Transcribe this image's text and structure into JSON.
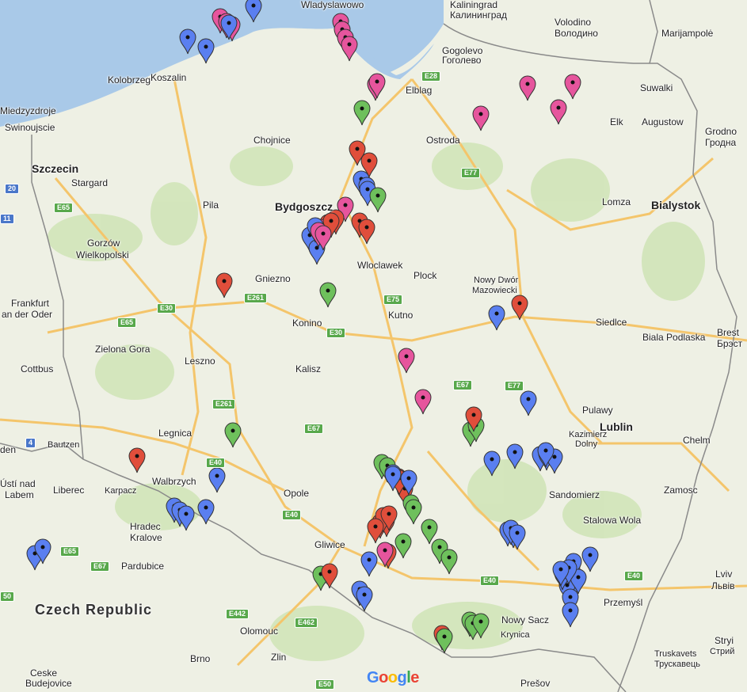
{
  "map": {
    "colors": {
      "land": "#eef0e4",
      "sea": "#a9c9e8",
      "border": "#8a8a8a",
      "road": "#f4c56b",
      "marker_blue": "#5a7ff0",
      "marker_red": "#e04e3b",
      "marker_green": "#6ec05c",
      "marker_pink": "#e6559d"
    },
    "labels": [
      {
        "text": "Wladyslawowo"
      },
      {
        "text": "Kaliningrad"
      },
      {
        "text": "Калининград"
      },
      {
        "text": "Volodino"
      },
      {
        "text": "Володино"
      },
      {
        "text": "Marijampolė"
      },
      {
        "text": "Gogolevo"
      },
      {
        "text": "Гоголево"
      },
      {
        "text": "Kolobrzeg"
      },
      {
        "text": "Koszalin"
      },
      {
        "text": "Elblag"
      },
      {
        "text": "Suwalki"
      },
      {
        "text": "Miedzyzdroje"
      },
      {
        "text": "Swinoujscie"
      },
      {
        "text": "Chojnice"
      },
      {
        "text": "Ostroda"
      },
      {
        "text": "Elk"
      },
      {
        "text": "Augustow"
      },
      {
        "text": "Grodno"
      },
      {
        "text": "Гродна"
      },
      {
        "text": "Szczecin"
      },
      {
        "text": "Stargard"
      },
      {
        "text": "Bydgoszcz"
      },
      {
        "text": "Pila"
      },
      {
        "text": "Lomza"
      },
      {
        "text": "Bialystok"
      },
      {
        "text": "Gorzów"
      },
      {
        "text": "Wielkopolski"
      },
      {
        "text": "Wloclawek"
      },
      {
        "text": "Gniezno"
      },
      {
        "text": "Plock"
      },
      {
        "text": "Nowy Dwór"
      },
      {
        "text": "Mazowiecki"
      },
      {
        "text": "Frankfurt"
      },
      {
        "text": "an der Oder"
      },
      {
        "text": "Konino"
      },
      {
        "text": "Kutno"
      },
      {
        "text": "Siedlce"
      },
      {
        "text": "Brest"
      },
      {
        "text": "Брэст"
      },
      {
        "text": "Biala Podlaska"
      },
      {
        "text": "Zielona Gora"
      },
      {
        "text": "Cottbus"
      },
      {
        "text": "Leszno"
      },
      {
        "text": "Kalisz"
      },
      {
        "text": "Pulawy"
      },
      {
        "text": "Lublin"
      },
      {
        "text": "Kazimierz"
      },
      {
        "text": "Dolny"
      },
      {
        "text": "Chelm"
      },
      {
        "text": "Legnica"
      },
      {
        "text": "Bautzen"
      },
      {
        "text": "den"
      },
      {
        "text": "Walbrzych"
      },
      {
        "text": "Ústí nad"
      },
      {
        "text": "Labem"
      },
      {
        "text": "Liberec"
      },
      {
        "text": "Karpacz"
      },
      {
        "text": "Opole"
      },
      {
        "text": "Sandomierz"
      },
      {
        "text": "Zamosc"
      },
      {
        "text": "Hradec"
      },
      {
        "text": "Kralove"
      },
      {
        "text": "Stalowa Wola"
      },
      {
        "text": "Gliwice"
      },
      {
        "text": "Pardubice"
      },
      {
        "text": "Lviv"
      },
      {
        "text": "Львів"
      },
      {
        "text": "Czech Republic"
      },
      {
        "text": "Przemyśl"
      },
      {
        "text": "Olomouc"
      },
      {
        "text": "Nowy Sacz"
      },
      {
        "text": "Krynica"
      },
      {
        "text": "Stryi"
      },
      {
        "text": "Стрий"
      },
      {
        "text": "Zlin"
      },
      {
        "text": "Truskavets"
      },
      {
        "text": "Трускавець"
      },
      {
        "text": "Brno"
      },
      {
        "text": "Ceske"
      },
      {
        "text": "Budejovice"
      },
      {
        "text": "Prešov"
      }
    ],
    "road_shields": [
      "E28",
      "20",
      "E65",
      "E77",
      "E261",
      "E30",
      "E75",
      "E30",
      "E65",
      "E67",
      "E77",
      "E261",
      "E67",
      "4",
      "E40",
      "E40",
      "E65",
      "E67",
      "E40",
      "E40",
      "E462",
      "E442",
      "50",
      "E50",
      "11"
    ],
    "markers": [
      {
        "color": "blue"
      },
      {
        "color": "pink"
      },
      {
        "color": "pink"
      },
      {
        "color": "pink"
      },
      {
        "color": "blue"
      },
      {
        "color": "blue"
      },
      {
        "color": "blue"
      },
      {
        "color": "pink"
      },
      {
        "color": "pink"
      },
      {
        "color": "pink"
      },
      {
        "color": "pink"
      },
      {
        "color": "pink"
      },
      {
        "color": "pink"
      },
      {
        "color": "pink"
      },
      {
        "color": "pink"
      },
      {
        "color": "pink"
      },
      {
        "color": "pink"
      },
      {
        "color": "green"
      },
      {
        "color": "red"
      },
      {
        "color": "red"
      },
      {
        "color": "blue"
      },
      {
        "color": "blue"
      },
      {
        "color": "blue"
      },
      {
        "color": "green"
      },
      {
        "color": "pink"
      },
      {
        "color": "red"
      },
      {
        "color": "red"
      },
      {
        "color": "pink"
      },
      {
        "color": "red"
      },
      {
        "color": "red"
      },
      {
        "color": "red"
      },
      {
        "color": "blue"
      },
      {
        "color": "blue"
      },
      {
        "color": "blue"
      },
      {
        "color": "pink"
      },
      {
        "color": "pink"
      },
      {
        "color": "red"
      },
      {
        "color": "green"
      },
      {
        "color": "red"
      },
      {
        "color": "blue"
      },
      {
        "color": "pink"
      },
      {
        "color": "pink"
      },
      {
        "color": "blue"
      },
      {
        "color": "green"
      },
      {
        "color": "green"
      },
      {
        "color": "red"
      },
      {
        "color": "blue"
      },
      {
        "color": "blue"
      },
      {
        "color": "blue"
      },
      {
        "color": "blue"
      },
      {
        "color": "blue"
      },
      {
        "color": "blue"
      },
      {
        "color": "green"
      },
      {
        "color": "red"
      },
      {
        "color": "blue"
      },
      {
        "color": "blue"
      },
      {
        "color": "blue"
      },
      {
        "color": "blue"
      },
      {
        "color": "blue"
      },
      {
        "color": "green"
      },
      {
        "color": "green"
      },
      {
        "color": "red"
      },
      {
        "color": "blue"
      },
      {
        "color": "red"
      },
      {
        "color": "green"
      },
      {
        "color": "red"
      },
      {
        "color": "red"
      },
      {
        "color": "red"
      },
      {
        "color": "red"
      },
      {
        "color": "red"
      },
      {
        "color": "green"
      },
      {
        "color": "green"
      },
      {
        "color": "green"
      },
      {
        "color": "green"
      },
      {
        "color": "green"
      },
      {
        "color": "blue"
      },
      {
        "color": "blue"
      },
      {
        "color": "blue"
      },
      {
        "color": "blue"
      },
      {
        "color": "red"
      },
      {
        "color": "pink"
      },
      {
        "color": "red"
      },
      {
        "color": "green"
      },
      {
        "color": "red"
      },
      {
        "color": "blue"
      },
      {
        "color": "blue"
      },
      {
        "color": "blue"
      },
      {
        "color": "blue"
      },
      {
        "color": "blue"
      },
      {
        "color": "blue"
      },
      {
        "color": "blue"
      },
      {
        "color": "blue"
      },
      {
        "color": "blue"
      },
      {
        "color": "blue"
      },
      {
        "color": "blue"
      },
      {
        "color": "blue"
      },
      {
        "color": "blue"
      },
      {
        "color": "blue"
      },
      {
        "color": "green"
      },
      {
        "color": "green"
      },
      {
        "color": "green"
      },
      {
        "color": "red"
      },
      {
        "color": "green"
      },
      {
        "color": "blue"
      },
      {
        "color": "blue"
      },
      {
        "color": "blue"
      },
      {
        "color": "blue"
      },
      {
        "color": "blue"
      }
    ],
    "attribution": "Google"
  }
}
